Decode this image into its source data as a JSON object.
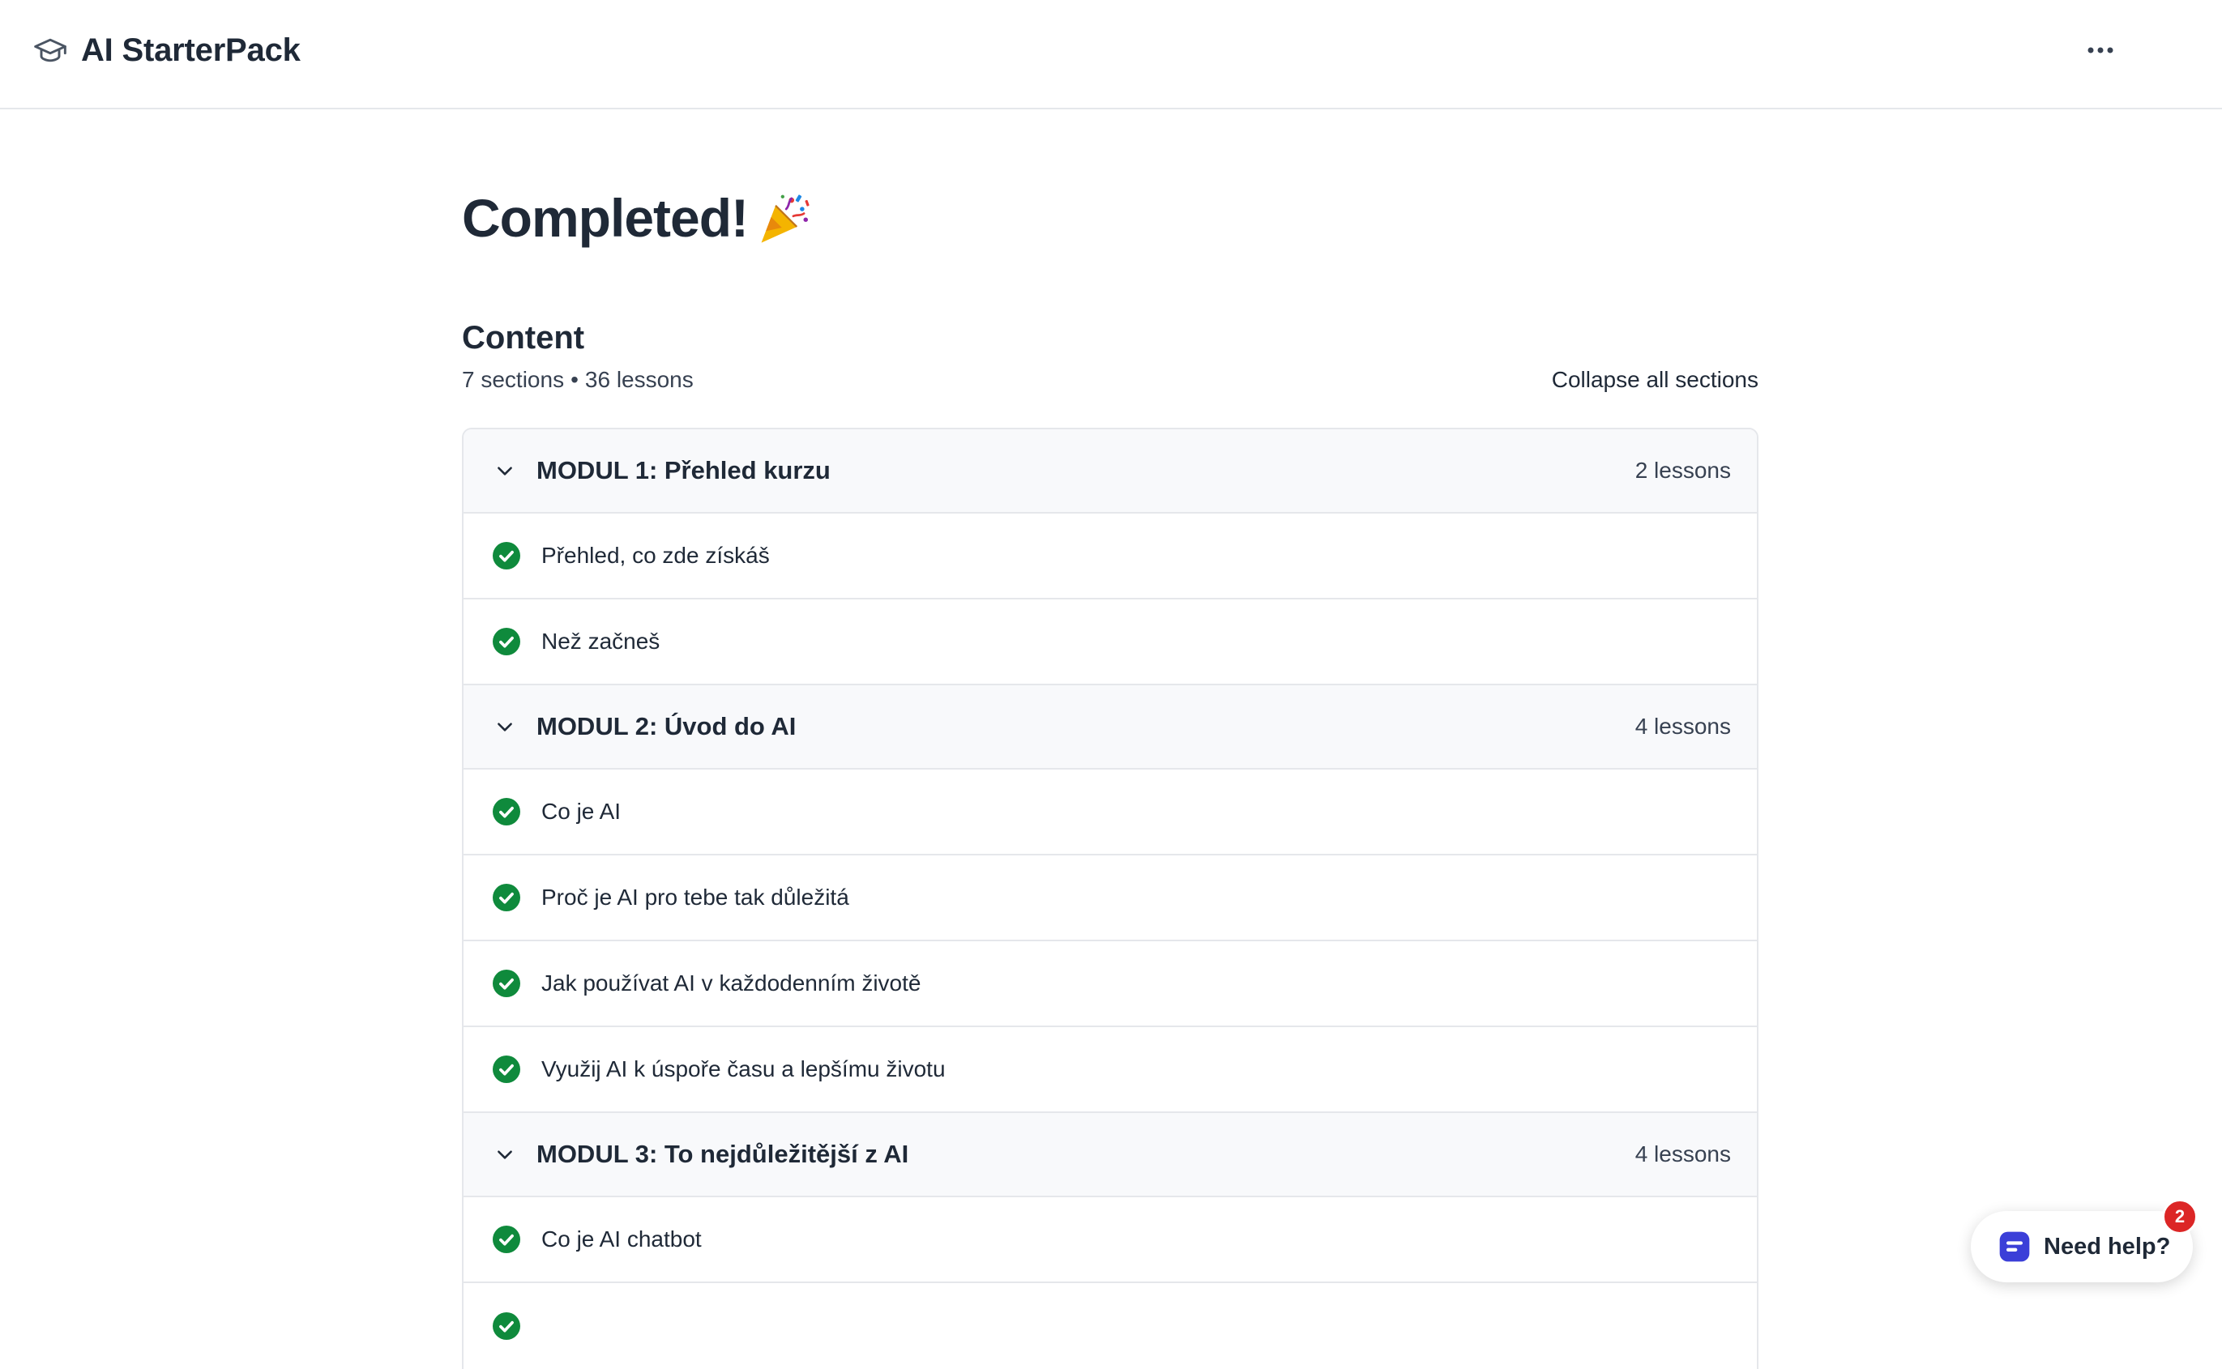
{
  "header": {
    "brand_title": "AI StarterPack",
    "brand_icon": "graduation-cap-icon",
    "menu_icon": "more-horizontal-icon"
  },
  "main": {
    "title": "Completed!",
    "title_icon": "party-popper-icon",
    "content_heading": "Content",
    "sections_count": "7 sections",
    "separator": "•",
    "lessons_count": "36 lessons",
    "collapse_label": "Collapse all sections"
  },
  "sections": [
    {
      "title": "MODUL 1: Přehled kurzu",
      "count": "2 lessons",
      "lessons": [
        "Přehled, co zde získáš",
        "Než začneš"
      ]
    },
    {
      "title": "MODUL 2: Úvod do AI",
      "count": "4 lessons",
      "lessons": [
        "Co je AI",
        "Proč je AI pro tebe tak důležitá",
        "Jak používat AI v každodenním životě",
        "Využij AI k úspoře času a lepšímu životu"
      ]
    },
    {
      "title": "MODUL 3: To nejdůležitější z AI",
      "count": "4 lessons",
      "lessons": [
        "Co je AI chatbot"
      ]
    }
  ],
  "help": {
    "label": "Need help?",
    "badge": "2",
    "icon": "chat-icon"
  },
  "colors": {
    "check_green": "#0f8a3c",
    "badge_red": "#dc2626",
    "help_icon_blue": "#3b3fd8",
    "text_dark": "#1f2937",
    "section_bg": "#f8f9fb",
    "border": "#e5e7eb"
  }
}
